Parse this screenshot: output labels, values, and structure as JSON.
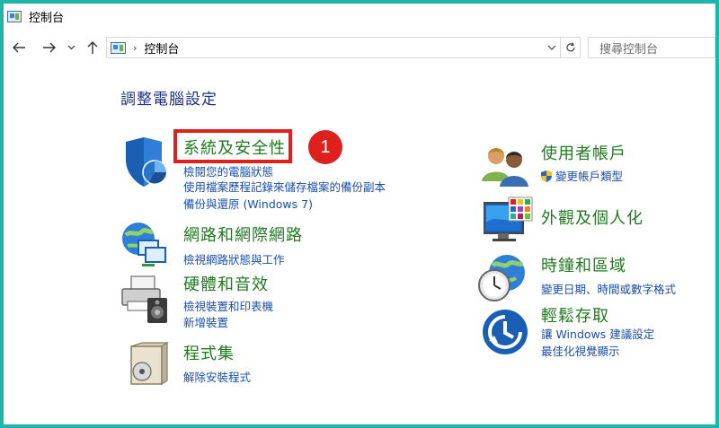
{
  "window": {
    "title": "控制台"
  },
  "nav": {
    "address": "控制台",
    "address_separator": "›",
    "search_placeholder": "搜尋控制台"
  },
  "main": {
    "heading": "調整電腦設定",
    "left_categories": [
      {
        "title": "系統及安全性",
        "links": [
          "檢閱您的電腦狀態",
          "使用檔案歷程記錄來儲存檔案的備份副本",
          "備份與還原 (Windows 7)"
        ]
      },
      {
        "title": "網路和網際網路",
        "links": [
          "檢視網路狀態與工作"
        ]
      },
      {
        "title": "硬體和音效",
        "links": [
          "檢視裝置和印表機",
          "新增裝置"
        ]
      },
      {
        "title": "程式集",
        "links": [
          "解除安裝程式"
        ]
      }
    ],
    "right_categories": [
      {
        "title": "使用者帳戶",
        "links": [
          "變更帳戶類型"
        ]
      },
      {
        "title": "外觀及個人化",
        "links": []
      },
      {
        "title": "時鐘和區域",
        "links": [
          "變更日期、時間或數字格式"
        ]
      },
      {
        "title": "輕鬆存取",
        "links": [
          "讓 Windows 建議設定",
          "最佳化視覺顯示"
        ]
      }
    ]
  },
  "annotation": {
    "step_number": "1"
  },
  "colors": {
    "frame": "#1fb5a8",
    "category_title": "#1f7a1f",
    "link": "#1a4fa8",
    "heading": "#1e3287",
    "highlight": "#e0201d"
  }
}
